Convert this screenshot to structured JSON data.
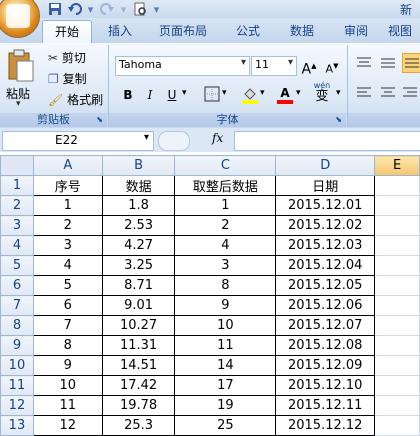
{
  "title_right": "新",
  "tabs": [
    "开始",
    "插入",
    "页面布局",
    "公式",
    "数据",
    "审阅",
    "视图"
  ],
  "clipboard": {
    "paste": "粘贴",
    "cut": "剪切",
    "copy": "复制",
    "format_painter": "格式刷",
    "group_label": "剪贴板"
  },
  "font": {
    "name": "Tahoma",
    "size": "11",
    "grow": "A",
    "shrink": "A",
    "bold": "B",
    "italic": "I",
    "underline": "U",
    "font_color": "A",
    "phonetic": "wén",
    "phonetic_char": "变",
    "group_label": "字体"
  },
  "namebox": "E22",
  "fx": "fx",
  "columns": [
    "A",
    "B",
    "C",
    "D",
    "E"
  ],
  "rows": [
    {
      "n": "1",
      "a": "序号",
      "b": "数据",
      "c": "取整后数据",
      "d": "日期"
    },
    {
      "n": "2",
      "a": "1",
      "b": "1.8",
      "c": "1",
      "d": "2015.12.01"
    },
    {
      "n": "3",
      "a": "2",
      "b": "2.53",
      "c": "2",
      "d": "2015.12.02"
    },
    {
      "n": "4",
      "a": "3",
      "b": "4.27",
      "c": "4",
      "d": "2015.12.03"
    },
    {
      "n": "5",
      "a": "4",
      "b": "3.25",
      "c": "3",
      "d": "2015.12.04"
    },
    {
      "n": "6",
      "a": "5",
      "b": "8.71",
      "c": "8",
      "d": "2015.12.05"
    },
    {
      "n": "7",
      "a": "6",
      "b": "9.01",
      "c": "9",
      "d": "2015.12.06"
    },
    {
      "n": "8",
      "a": "7",
      "b": "10.27",
      "c": "10",
      "d": "2015.12.07"
    },
    {
      "n": "9",
      "a": "8",
      "b": "11.31",
      "c": "11",
      "d": "2015.12.08"
    },
    {
      "n": "10",
      "a": "9",
      "b": "14.51",
      "c": "14",
      "d": "2015.12.09"
    },
    {
      "n": "11",
      "a": "10",
      "b": "17.42",
      "c": "17",
      "d": "2015.12.10"
    },
    {
      "n": "12",
      "a": "11",
      "b": "19.78",
      "c": "19",
      "d": "2015.12.11"
    },
    {
      "n": "13",
      "a": "12",
      "b": "25.3",
      "c": "25",
      "d": "2015.12.12"
    }
  ]
}
